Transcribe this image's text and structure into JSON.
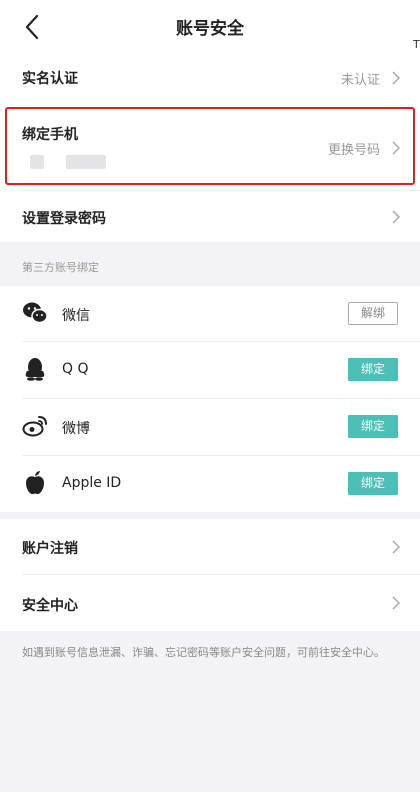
{
  "header": {
    "title": "账号安全"
  },
  "edge_mark": "T",
  "account": {
    "real_name": {
      "label": "实名认证",
      "value": "未认证"
    },
    "phone": {
      "label": "绑定手机",
      "value": "更换号码"
    },
    "password": {
      "label": "设置登录密码"
    }
  },
  "third_party": {
    "section_title": "第三方账号绑定",
    "items": [
      {
        "name": "微信",
        "icon": "wechat-icon",
        "action": "解绑"
      },
      {
        "name": "Q Q",
        "icon": "qq-icon",
        "action": "绑定"
      },
      {
        "name": "微博",
        "icon": "weibo-icon",
        "action": "绑定"
      },
      {
        "name": "Apple ID",
        "icon": "apple-icon",
        "action": "绑定"
      }
    ]
  },
  "more": {
    "deactivate": {
      "label": "账户注销"
    },
    "security_center": {
      "label": "安全中心"
    }
  },
  "footer": {
    "note": "如遇到账号信息泄漏、诈骗、忘记密码等账户安全问题，可前往安全中心。"
  },
  "colors": {
    "bind_button": "#4cc0b6",
    "highlight": "#e02020",
    "background": "#f3f3f5"
  }
}
